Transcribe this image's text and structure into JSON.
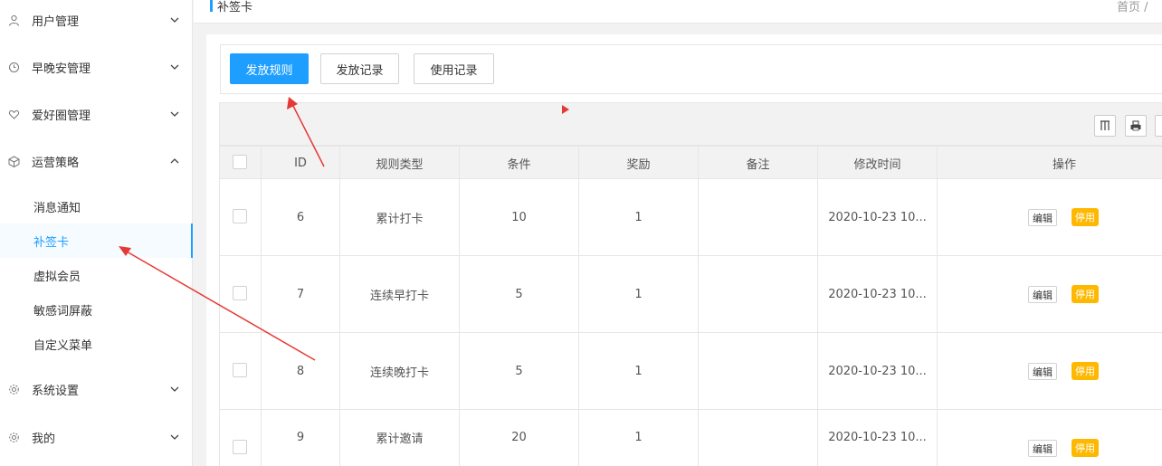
{
  "sidebar": {
    "menus": [
      {
        "label": "用户管理",
        "icon": "user-icon",
        "expanded": false
      },
      {
        "label": "早晚安管理",
        "icon": "clock-icon",
        "expanded": false
      },
      {
        "label": "爱好圈管理",
        "icon": "heart-icon",
        "expanded": false
      },
      {
        "label": "运营策略",
        "icon": "cube-icon",
        "expanded": true
      },
      {
        "label": "系统设置",
        "icon": "gear-icon",
        "expanded": false
      },
      {
        "label": "我的",
        "icon": "gear-icon",
        "expanded": false
      }
    ],
    "submenu": [
      {
        "label": "消息通知"
      },
      {
        "label": "补签卡",
        "active": true
      },
      {
        "label": "虚拟会员"
      },
      {
        "label": "敏感词屏蔽"
      },
      {
        "label": "自定义菜单"
      }
    ]
  },
  "header": {
    "title": "补签卡",
    "breadcrumb": "首页 /"
  },
  "buttons": {
    "issue_rules": "发放规则",
    "issue_records": "发放记录",
    "usage_records": "使用记录"
  },
  "table": {
    "columns": [
      "ID",
      "规则类型",
      "条件",
      "奖励",
      "备注",
      "修改时间",
      "操作"
    ],
    "rows": [
      {
        "id": "6",
        "type": "累计打卡",
        "condition": "10",
        "reward": "1",
        "note": "",
        "modified": "2020-10-23 10..."
      },
      {
        "id": "7",
        "type": "连续早打卡",
        "condition": "5",
        "reward": "1",
        "note": "",
        "modified": "2020-10-23 10..."
      },
      {
        "id": "8",
        "type": "连续晚打卡",
        "condition": "5",
        "reward": "1",
        "note": "",
        "modified": "2020-10-23 10..."
      },
      {
        "id": "9",
        "type": "累计邀请",
        "condition": "20",
        "reward": "1",
        "note": "",
        "modified": "2020-10-23 10..."
      }
    ],
    "actions": {
      "edit": "编辑",
      "disable": "停用"
    }
  },
  "colors": {
    "accent": "#1e9fff",
    "warn": "#ffb800",
    "annotation": "#e53935"
  }
}
